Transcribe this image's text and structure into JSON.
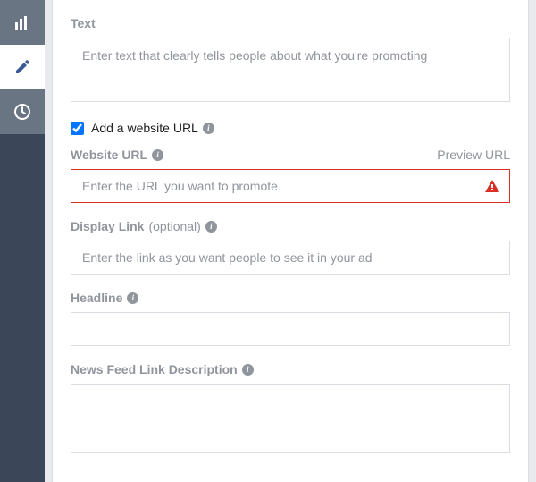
{
  "sidebar": {
    "items": [
      {
        "name": "charts"
      },
      {
        "name": "edit"
      },
      {
        "name": "history"
      }
    ]
  },
  "form": {
    "text": {
      "label": "Text",
      "placeholder": "Enter text that clearly tells people about what you're promoting",
      "value": ""
    },
    "addUrl": {
      "label": "Add a website URL",
      "checked": true
    },
    "websiteUrl": {
      "label": "Website URL",
      "previewLabel": "Preview URL",
      "placeholder": "Enter the URL you want to promote",
      "value": "",
      "error": true
    },
    "displayLink": {
      "label": "Display Link",
      "optional": "(optional)",
      "placeholder": "Enter the link as you want people to see it in your ad",
      "value": ""
    },
    "headline": {
      "label": "Headline",
      "value": ""
    },
    "newsFeedDesc": {
      "label": "News Feed Link Description",
      "value": ""
    }
  }
}
